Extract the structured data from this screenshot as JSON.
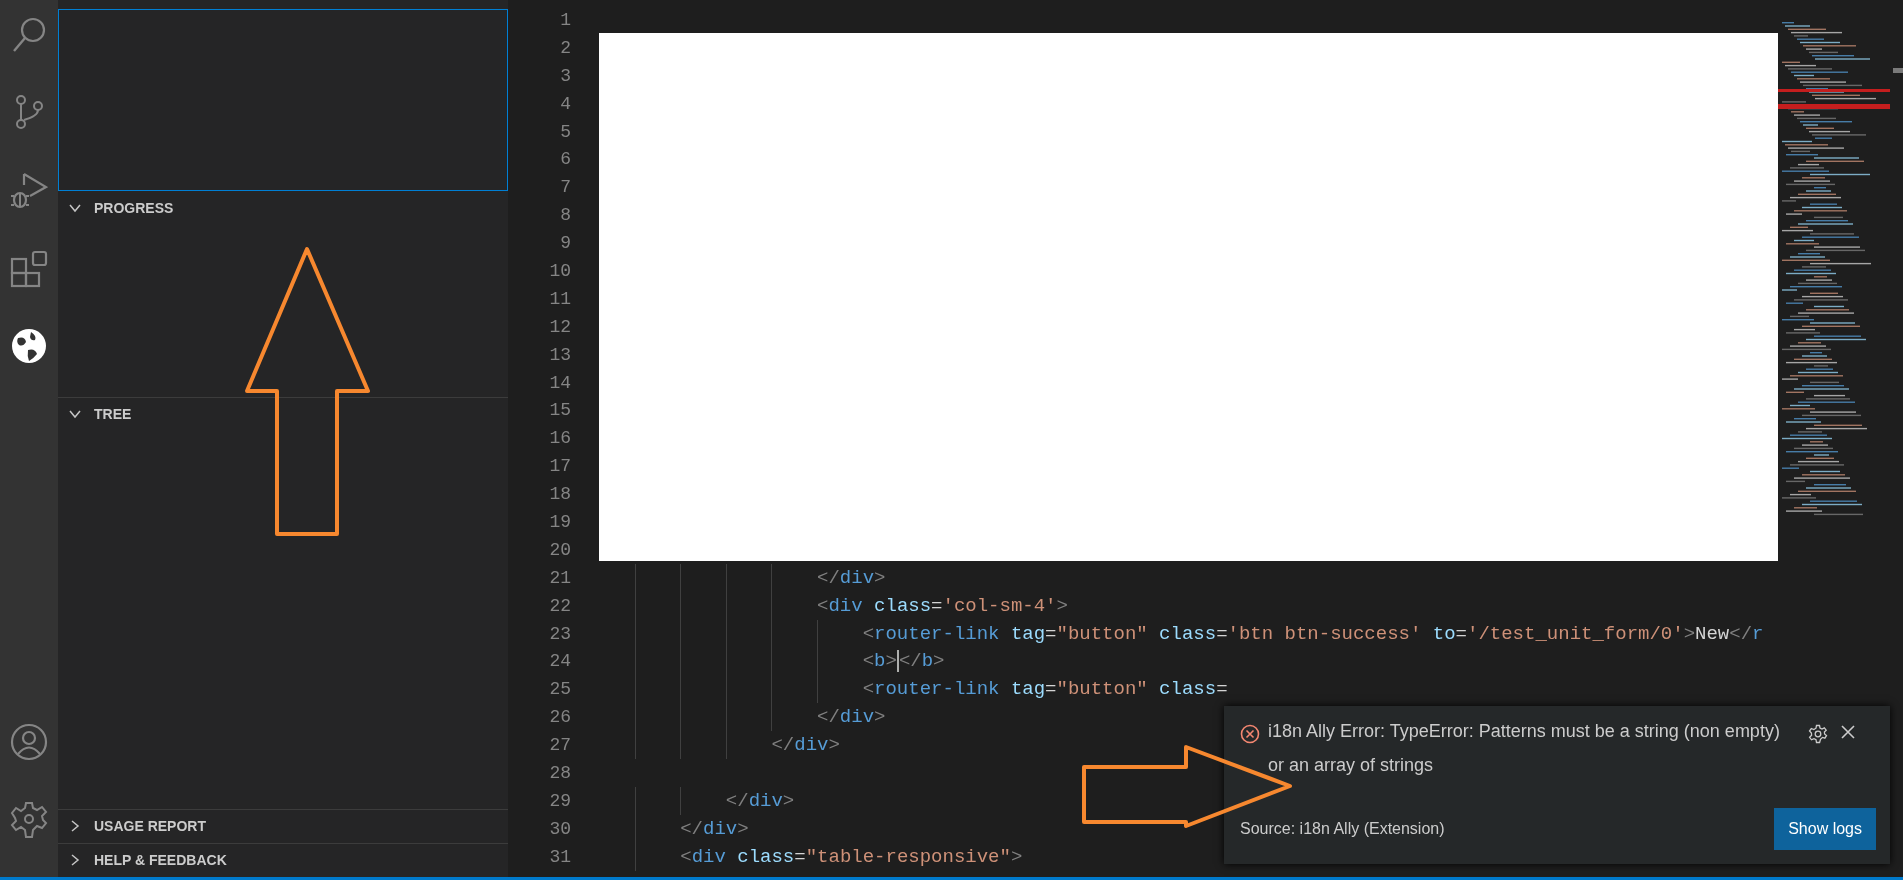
{
  "activity_bar": {
    "items": [
      {
        "kind": "search",
        "selected": false
      },
      {
        "kind": "source-control",
        "selected": false
      },
      {
        "kind": "run",
        "selected": false
      },
      {
        "kind": "extensions",
        "selected": false
      },
      {
        "kind": "globe",
        "selected": true
      }
    ],
    "bottom_items": [
      {
        "kind": "account"
      },
      {
        "kind": "settings"
      }
    ]
  },
  "sidebar": {
    "top_view": {
      "focused": true
    },
    "sections": [
      {
        "title": "PROGRESS",
        "expanded": true
      },
      {
        "title": "TREE",
        "expanded": true
      },
      {
        "title": "USAGE REPORT",
        "expanded": false
      },
      {
        "title": "HELP & FEEDBACK",
        "expanded": false
      }
    ]
  },
  "editor": {
    "lines": [
      {
        "number": "1"
      },
      {
        "number": "2"
      },
      {
        "number": "3"
      },
      {
        "number": "4"
      },
      {
        "number": "5"
      },
      {
        "number": "6"
      },
      {
        "number": "7"
      },
      {
        "number": "8"
      },
      {
        "number": "9"
      },
      {
        "number": "10"
      },
      {
        "number": "11"
      },
      {
        "number": "12"
      },
      {
        "number": "13"
      },
      {
        "number": "14"
      },
      {
        "number": "15"
      },
      {
        "number": "16"
      },
      {
        "number": "17"
      },
      {
        "number": "18"
      },
      {
        "number": "19"
      },
      {
        "number": "20"
      },
      {
        "number": "21",
        "tokens": [
          {
            "kind": "punct",
            "text": "                    </"
          },
          {
            "kind": "tag",
            "text": "div"
          },
          {
            "kind": "punct",
            "text": ">"
          }
        ]
      },
      {
        "number": "22",
        "tokens": [
          {
            "kind": "punct",
            "text": "                    <"
          },
          {
            "kind": "tag",
            "text": "div"
          },
          {
            "kind": "attr",
            "text": " class"
          },
          {
            "kind": "text",
            "text": "="
          },
          {
            "kind": "string",
            "text": "'col-sm-4'"
          },
          {
            "kind": "punct",
            "text": ">"
          }
        ]
      },
      {
        "number": "23",
        "tokens": [
          {
            "kind": "punct",
            "text": "                        <"
          },
          {
            "kind": "tag",
            "text": "router-link"
          },
          {
            "kind": "attr",
            "text": " tag"
          },
          {
            "kind": "text",
            "text": "="
          },
          {
            "kind": "string",
            "text": "\"button\""
          },
          {
            "kind": "attr",
            "text": " class"
          },
          {
            "kind": "text",
            "text": "="
          },
          {
            "kind": "string",
            "text": "'btn btn-success'"
          },
          {
            "kind": "attr",
            "text": " to"
          },
          {
            "kind": "text",
            "text": "="
          },
          {
            "kind": "string",
            "text": "'/test_unit_form/0'"
          },
          {
            "kind": "punct",
            "text": ">"
          },
          {
            "kind": "text",
            "text": "New"
          },
          {
            "kind": "punct",
            "text": "</"
          },
          {
            "kind": "tag",
            "text": "r"
          }
        ]
      },
      {
        "number": "24",
        "tokens": [
          {
            "kind": "punct",
            "text": "                        <"
          },
          {
            "kind": "tag",
            "text": "b"
          },
          {
            "kind": "punct",
            "text": ">"
          },
          {
            "kind": "cursor"
          },
          {
            "kind": "punct",
            "text": "</"
          },
          {
            "kind": "tag",
            "text": "b"
          },
          {
            "kind": "punct",
            "text": ">"
          }
        ]
      },
      {
        "number": "25",
        "tokens": [
          {
            "kind": "punct",
            "text": "                        <"
          },
          {
            "kind": "tag",
            "text": "router-link"
          },
          {
            "kind": "attr",
            "text": " tag"
          },
          {
            "kind": "text",
            "text": "="
          },
          {
            "kind": "string",
            "text": "\"button\""
          },
          {
            "kind": "attr",
            "text": " class"
          },
          {
            "kind": "text",
            "text": "="
          }
        ]
      },
      {
        "number": "26",
        "tokens": [
          {
            "kind": "punct",
            "text": "                    </"
          },
          {
            "kind": "tag",
            "text": "div"
          },
          {
            "kind": "punct",
            "text": ">"
          }
        ]
      },
      {
        "number": "27",
        "tokens": [
          {
            "kind": "punct",
            "text": "                </"
          },
          {
            "kind": "tag",
            "text": "div"
          },
          {
            "kind": "punct",
            "text": ">"
          }
        ]
      },
      {
        "number": "28"
      },
      {
        "number": "29",
        "tokens": [
          {
            "kind": "punct",
            "text": "            </"
          },
          {
            "kind": "tag",
            "text": "div"
          },
          {
            "kind": "punct",
            "text": ">"
          }
        ]
      },
      {
        "number": "30",
        "tokens": [
          {
            "kind": "punct",
            "text": "        </"
          },
          {
            "kind": "tag",
            "text": "div"
          },
          {
            "kind": "punct",
            "text": ">"
          }
        ]
      },
      {
        "number": "31",
        "tokens": [
          {
            "kind": "punct",
            "text": "        <"
          },
          {
            "kind": "tag",
            "text": "div"
          },
          {
            "kind": "attr",
            "text": " class"
          },
          {
            "kind": "text",
            "text": "="
          },
          {
            "kind": "string",
            "text": "\"table-responsive\""
          },
          {
            "kind": "punct",
            "text": ">"
          }
        ]
      }
    ]
  },
  "notification": {
    "message": "i18n Ally Error: TypeError: Patterns must be a string (non empty) or an array of strings",
    "source": "Source: i18n Ally (Extension)",
    "button": "Show logs"
  }
}
